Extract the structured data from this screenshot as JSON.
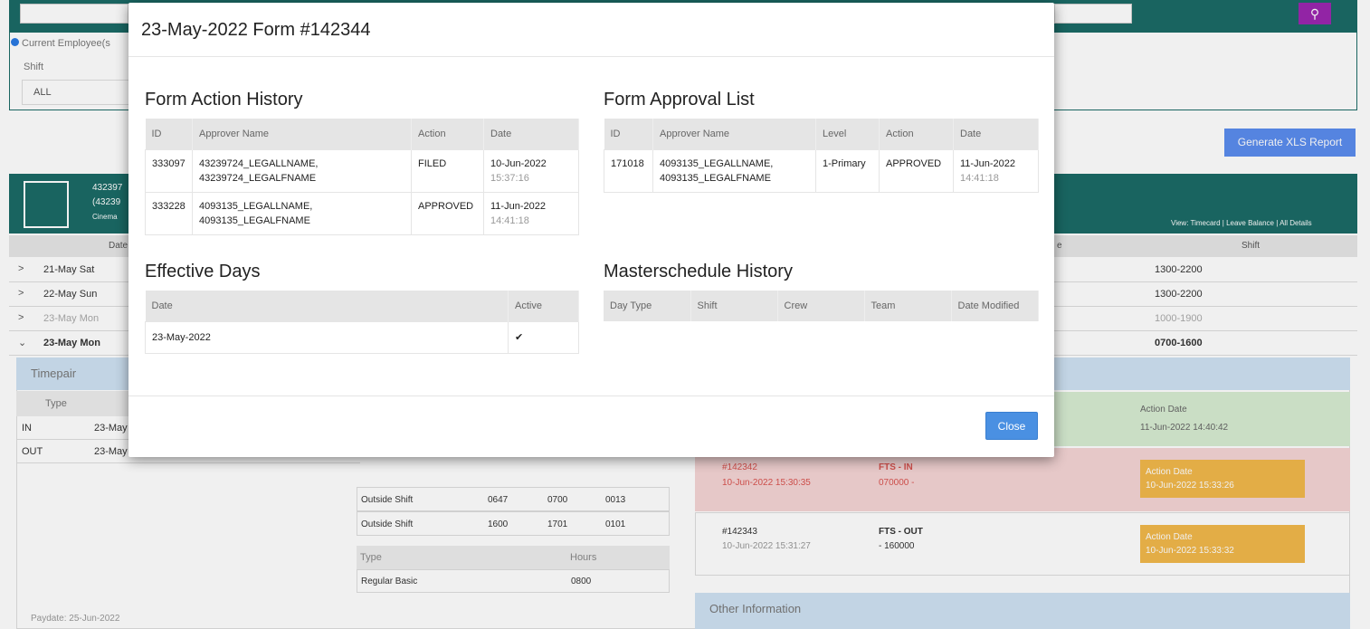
{
  "background": {
    "radio_label": "Current Employee(s",
    "shift_label": "Shift",
    "shift_value": "ALL",
    "generate_button": "Generate XLS Report",
    "employee": {
      "line1": "432397",
      "line2": "(43239",
      "line3": "Cinema"
    },
    "view_links": "View: Timecard | Leave Balance | All Details",
    "grid_headers": {
      "date": "Date",
      "shift": "Shift",
      "e": "e"
    },
    "rows": [
      {
        "date": "21-May Sat",
        "shift": "1300-2200"
      },
      {
        "date": "22-May Sun",
        "shift": "1300-2200"
      },
      {
        "date": "23-May Mon",
        "shift": "1000-1900"
      },
      {
        "date": "23-May Mon",
        "shift": "0700-1600"
      }
    ],
    "timepair": {
      "title": "Timepair",
      "type_header": "Type",
      "rows": [
        {
          "type": "IN",
          "date": "23-May"
        },
        {
          "type": "OUT",
          "date": "23-May"
        }
      ]
    },
    "outside_rows": [
      {
        "label": "Outside Shift",
        "a": "0647",
        "b": "0700",
        "c": "0013"
      },
      {
        "label": "Outside Shift",
        "a": "1600",
        "b": "1701",
        "c": "0101"
      }
    ],
    "type_table": {
      "header_type": "Type",
      "header_hours": "Hours",
      "row_type": "Regular Basic",
      "row_hours": "0800"
    },
    "green_card": {
      "label": "Action Date",
      "value": "11-Jun-2022 14:40:42"
    },
    "red_card": {
      "form": "#142342",
      "filed": "10-Jun-2022 15:30:35",
      "type": "FTS - IN",
      "detail": "070000 -",
      "badge_label": "Action Date",
      "badge_value": "10-Jun-2022 15:33:26"
    },
    "white_card": {
      "form": "#142343",
      "filed": "10-Jun-2022 15:31:27",
      "type": "FTS - OUT",
      "detail": "- 160000",
      "badge_label": "Action Date",
      "badge_value": "10-Jun-2022 15:33:32"
    },
    "other_information": "Other Information",
    "paydate": "Paydate: 25-Jun-2022"
  },
  "modal": {
    "title": "23-May-2022 Form #142344",
    "action_history": {
      "title": "Form Action History",
      "headers": [
        "ID",
        "Approver Name",
        "Action",
        "Date"
      ],
      "rows": [
        {
          "id": "333097",
          "name1": "43239724_LEGALLNAME,",
          "name2": "43239724_LEGALFNAME",
          "action": "FILED",
          "date": "10-Jun-2022",
          "time": "15:37:16"
        },
        {
          "id": "333228",
          "name1": "4093135_LEGALLNAME,",
          "name2": "4093135_LEGALFNAME",
          "action": "APPROVED",
          "date": "11-Jun-2022",
          "time": "14:41:18"
        }
      ]
    },
    "approval_list": {
      "title": "Form Approval List",
      "headers": [
        "ID",
        "Approver Name",
        "Level",
        "Action",
        "Date"
      ],
      "rows": [
        {
          "id": "171018",
          "name1": "4093135_LEGALLNAME,",
          "name2": "4093135_LEGALFNAME",
          "level": "1-Primary",
          "action": "APPROVED",
          "date": "11-Jun-2022",
          "time": "14:41:18"
        }
      ]
    },
    "effective_days": {
      "title": "Effective Days",
      "headers": [
        "Date",
        "Active"
      ],
      "rows": [
        {
          "date": "23-May-2022",
          "active": "✔"
        }
      ]
    },
    "masterschedule": {
      "title": "Masterschedule History",
      "headers": [
        "Day Type",
        "Shift",
        "Crew",
        "Team",
        "Date Modified"
      ]
    },
    "close_label": "Close"
  }
}
